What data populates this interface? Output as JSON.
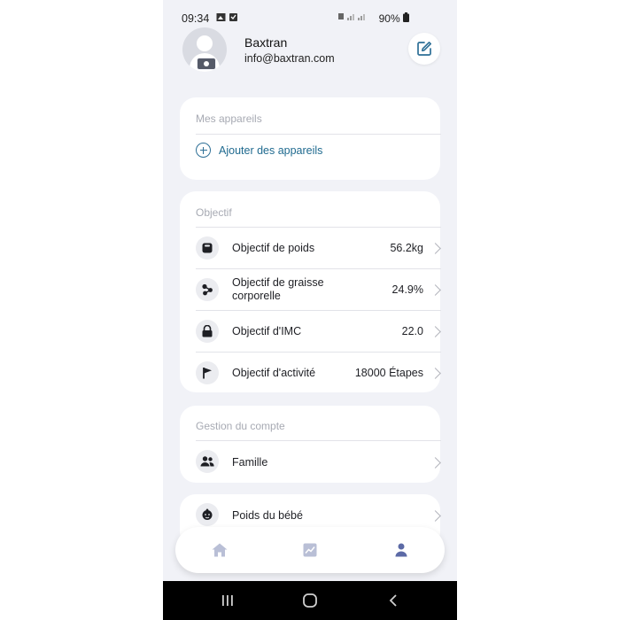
{
  "status_bar": {
    "time": "09:34",
    "battery": "90%"
  },
  "profile": {
    "name": "Baxtran",
    "email": "info@baxtran.com"
  },
  "devices": {
    "title": "Mes appareils",
    "add_label": "Ajouter des appareils"
  },
  "objectives": {
    "title": "Objectif",
    "items": [
      {
        "label": "Objectif de poids",
        "value": "56.2kg",
        "icon": "scale-icon"
      },
      {
        "label": "Objectif de graisse corporelle",
        "label_line1": "Objectif de graisse",
        "label_line2": "corporelle",
        "value": "24.9%",
        "icon": "body-fat-icon"
      },
      {
        "label": "Objectif d'IMC",
        "value": "22.0",
        "icon": "bmi-icon"
      },
      {
        "label": "Objectif d'activité",
        "value": "18000 Étapes",
        "icon": "flag-icon"
      }
    ]
  },
  "account": {
    "title": "Gestion du compte",
    "items": [
      {
        "label": "Famille",
        "icon": "family-icon"
      },
      {
        "label": "Poids du bébé",
        "icon": "baby-icon"
      }
    ]
  },
  "tabs": [
    {
      "name": "home",
      "icon": "home-icon",
      "active": false
    },
    {
      "name": "charts",
      "icon": "chart-icon",
      "active": false
    },
    {
      "name": "profile",
      "icon": "user-icon",
      "active": true
    }
  ],
  "colors": {
    "accent": "#1f6a8f",
    "tab_active": "#5c6aa6",
    "tab_inactive": "#b9bfd6",
    "background": "#f1f2f7"
  }
}
